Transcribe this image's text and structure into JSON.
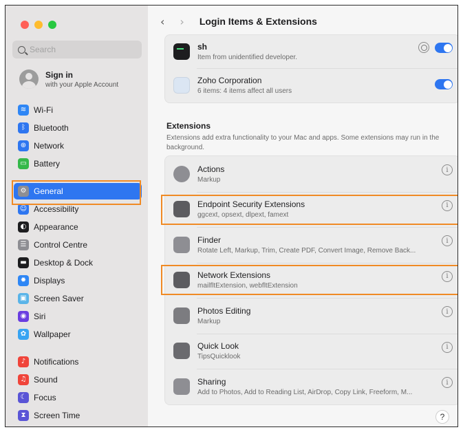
{
  "sidebar": {
    "search_placeholder": "Search",
    "account": {
      "name": "Sign in",
      "subtitle": "with your Apple Account"
    },
    "items": [
      {
        "label": "Wi-Fi",
        "icon": "wifi-icon",
        "color": "#2e86f5",
        "glyph": "≋"
      },
      {
        "label": "Bluetooth",
        "icon": "bluetooth-icon",
        "color": "#2e76f0",
        "glyph": "ᛒ"
      },
      {
        "label": "Network",
        "icon": "network-globe-icon",
        "color": "#2e76f0",
        "glyph": "⊕"
      },
      {
        "label": "Battery",
        "icon": "battery-icon",
        "color": "#35b84a",
        "glyph": "▭"
      },
      {
        "label": "General",
        "icon": "gear-icon",
        "color": "#8e8e93",
        "glyph": "⚙",
        "selected": true
      },
      {
        "label": "Accessibility",
        "icon": "accessibility-icon",
        "color": "#2e76f0",
        "glyph": "☺"
      },
      {
        "label": "Appearance",
        "icon": "appearance-icon",
        "color": "#1d1d1f",
        "glyph": "◐"
      },
      {
        "label": "Control Centre",
        "icon": "control-centre-icon",
        "color": "#8e8e93",
        "glyph": "☰"
      },
      {
        "label": "Desktop & Dock",
        "icon": "desktop-dock-icon",
        "color": "#1d1d1f",
        "glyph": "▬"
      },
      {
        "label": "Displays",
        "icon": "displays-icon",
        "color": "#2e86f5",
        "glyph": "✹"
      },
      {
        "label": "Screen Saver",
        "icon": "screen-saver-icon",
        "color": "#5ab4e8",
        "glyph": "▣"
      },
      {
        "label": "Siri",
        "icon": "siri-icon",
        "color": "#6a3de0",
        "glyph": "◉"
      },
      {
        "label": "Wallpaper",
        "icon": "wallpaper-icon",
        "color": "#38a4f2",
        "glyph": "✿"
      },
      {
        "label": "Notifications",
        "icon": "notifications-bell-icon",
        "color": "#f0443a",
        "glyph": "♪"
      },
      {
        "label": "Sound",
        "icon": "sound-speaker-icon",
        "color": "#f0443a",
        "glyph": "♫"
      },
      {
        "label": "Focus",
        "icon": "focus-moon-icon",
        "color": "#5a55d6",
        "glyph": "☾"
      },
      {
        "label": "Screen Time",
        "icon": "screen-time-icon",
        "color": "#5a55d6",
        "glyph": "⧗"
      }
    ]
  },
  "header": {
    "title": "Login Items & Extensions",
    "back": "‹",
    "forward": "›"
  },
  "login_items": [
    {
      "name": "sh",
      "desc": "Item from unidentified developer.",
      "enabled": true
    },
    {
      "name": "Zoho Corporation",
      "desc": "6 items: 4 items affect all users",
      "enabled": true
    }
  ],
  "extensions": {
    "title": "Extensions",
    "description": "Extensions add extra functionality to your Mac and apps. Some extensions may run in the background.",
    "items": [
      {
        "name": "Actions",
        "desc": "Markup",
        "icon": "actions-icon"
      },
      {
        "name": "Endpoint Security Extensions",
        "desc": "ggcext, opsext, dlpext, famext",
        "icon": "extension-plug-icon",
        "highlighted": true
      },
      {
        "name": "Finder",
        "desc": "Rotate Left, Markup, Trim, Create PDF, Convert Image, Remove Back...",
        "icon": "finder-icon"
      },
      {
        "name": "Network Extensions",
        "desc": "mailfltExtension, webfltExtension",
        "icon": "extension-plug-icon",
        "highlighted": true
      },
      {
        "name": "Photos Editing",
        "desc": "Markup",
        "icon": "photos-icon"
      },
      {
        "name": "Quick Look",
        "desc": "TipsQuicklook",
        "icon": "quick-look-eye-icon"
      },
      {
        "name": "Sharing",
        "desc": "Add to Photos, Add to Reading List, AirDrop, Copy Link, Freeform, M...",
        "icon": "share-icon"
      }
    ]
  },
  "info_glyph": "i",
  "help_label": "?"
}
